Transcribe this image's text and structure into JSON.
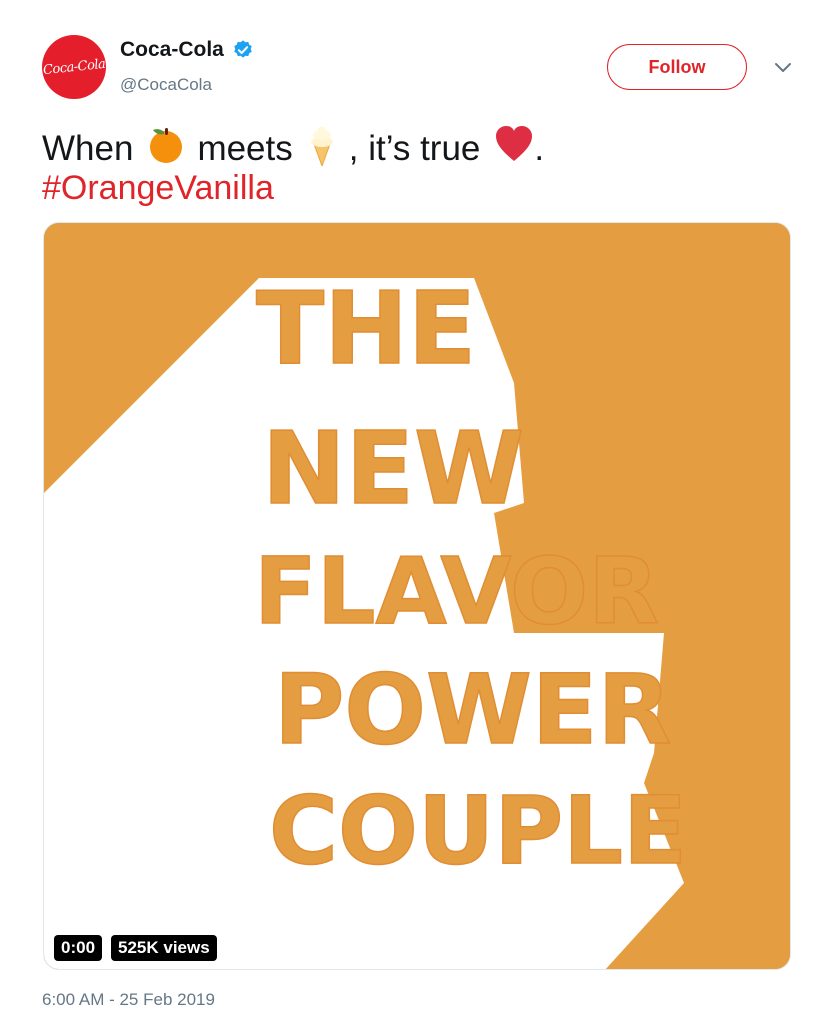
{
  "header": {
    "avatar_logo_text": "Coca-Cola",
    "display_name": "Coca-Cola",
    "handle": "@CocaCola",
    "verified_icon": "verified-badge-icon",
    "follow_label": "Follow",
    "menu_icon": "chevron-down-icon"
  },
  "tweet": {
    "text_when": "When",
    "emoji_1": "orange-emoji",
    "text_meets": "meets",
    "emoji_2": "soft-serve-emoji",
    "text_true": ", it’s true",
    "emoji_3": "red-heart-emoji",
    "text_end": ".",
    "hashtag": "#OrangeVanilla"
  },
  "media": {
    "headline_lines": [
      "THE",
      "NEW",
      "FLAVOR",
      "POWER",
      "COUPLE"
    ],
    "video_time": "0:00",
    "video_views": "525K views"
  },
  "footer": {
    "timestamp": "6:00 AM - 25 Feb 2019"
  },
  "colors": {
    "brand_red": "#e0252a",
    "media_orange": "#e59d41",
    "text": "#14171a",
    "muted": "#657786",
    "verified_blue": "#1da1f2",
    "heart_red": "#dd2e44"
  }
}
